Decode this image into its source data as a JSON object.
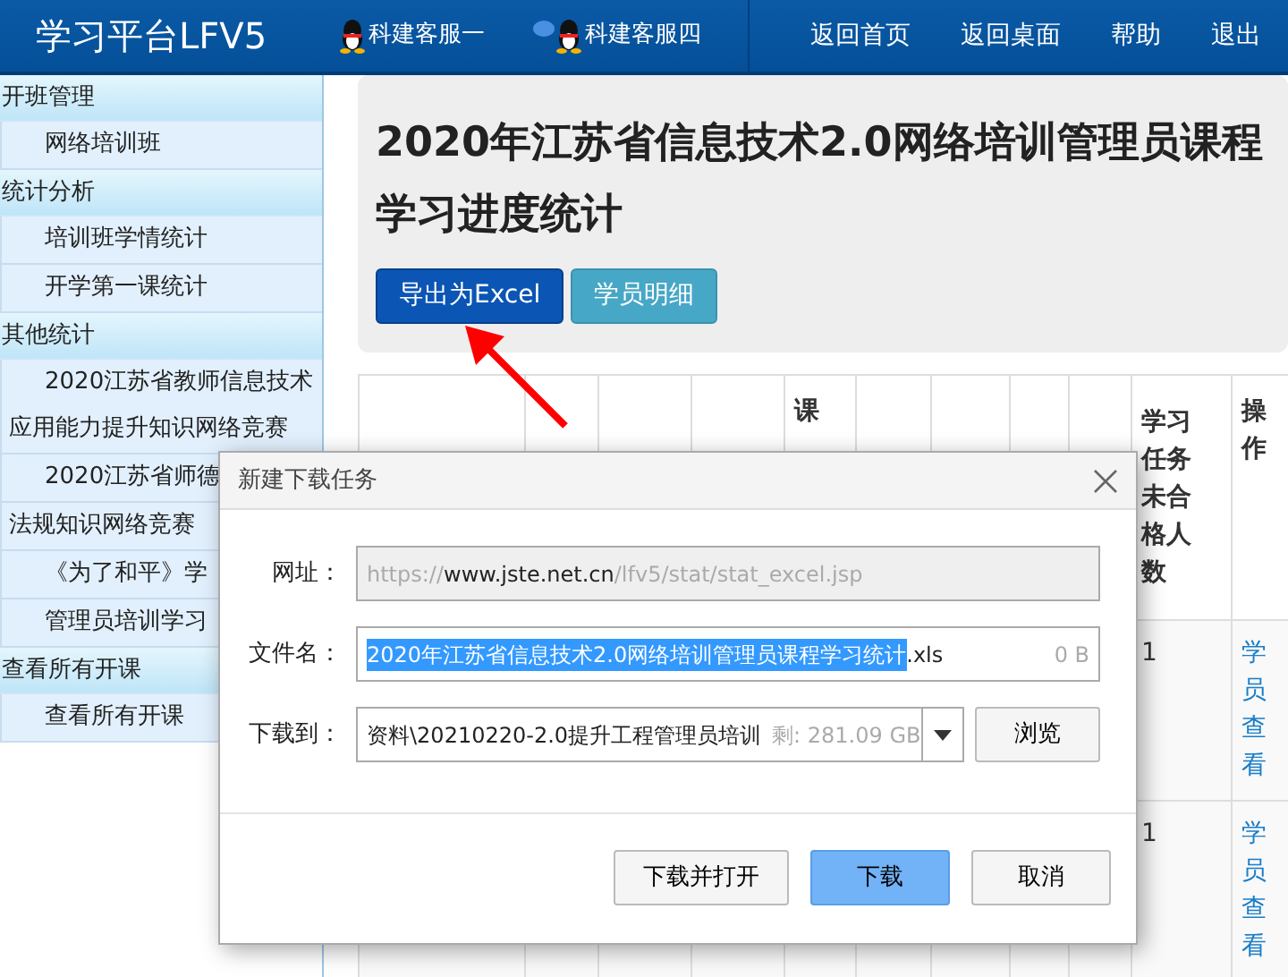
{
  "header": {
    "title": "学习平台LFV5",
    "service_links": [
      {
        "label": "科建客服一",
        "bubble": false
      },
      {
        "label": "科建客服四",
        "bubble": true
      }
    ],
    "nav": [
      "返回首页",
      "返回桌面",
      "帮助",
      "退出"
    ]
  },
  "sidebar": [
    {
      "label": "开班管理",
      "children": [
        {
          "label": "网络培训班"
        }
      ]
    },
    {
      "label": "统计分析",
      "children": [
        {
          "label": "培训班学情统计"
        },
        {
          "label": "开学第一课统计"
        }
      ]
    },
    {
      "label": "其他统计",
      "children": [
        {
          "label": "2020江苏省教师信息技术应用能力提升知识网络竞赛"
        },
        {
          "label": "2020江苏省师德"
        },
        {
          "label": "法规知识网络竞赛",
          "continued": true
        },
        {
          "label": "《为了和平》学"
        },
        {
          "label": "管理员培训学习"
        }
      ]
    },
    {
      "label": "查看所有开课",
      "children": [
        {
          "label": "查看所有开课"
        }
      ]
    }
  ],
  "page": {
    "title": "2020年江苏省信息技术2.0网络培训管理员课程学习进度统计",
    "buttons": [
      {
        "label": "导出为Excel",
        "kind": "primary"
      },
      {
        "label": "学员明细",
        "kind": "info"
      }
    ]
  },
  "table": {
    "columns": [
      {},
      {},
      {},
      {},
      {
        "label": "课"
      },
      {},
      {},
      {},
      {},
      {
        "label": "学习任务未合格人数"
      },
      {
        "label": "操作"
      }
    ],
    "rows": [
      {
        "failed_count": "1",
        "action": "学员查看"
      },
      {
        "failed_count": "1",
        "action": "学员查看"
      }
    ]
  },
  "dialog": {
    "title": "新建下载任务",
    "url": {
      "label": "网址：",
      "parts": [
        {
          "text": "https://",
          "emphasis": false
        },
        {
          "text": "www.jste.net.cn",
          "emphasis": true
        },
        {
          "text": "/lfv5/stat/stat_excel.jsp",
          "emphasis": false
        }
      ]
    },
    "filename": {
      "label": "文件名：",
      "selected_text": "2020年江苏省信息技术2.0网络培训管理员课程学习统计",
      "rest": ".xls",
      "size": "0 B"
    },
    "destination": {
      "label": "下载到：",
      "path": "资料\\20210220-2.0提升工程管理员培训",
      "free": "剩: 281.09 GB",
      "browse": "浏览"
    },
    "buttons": [
      {
        "label": "下载并打开",
        "kind": "default"
      },
      {
        "label": "下载",
        "kind": "primary"
      },
      {
        "label": "取消",
        "kind": "default"
      }
    ]
  }
}
